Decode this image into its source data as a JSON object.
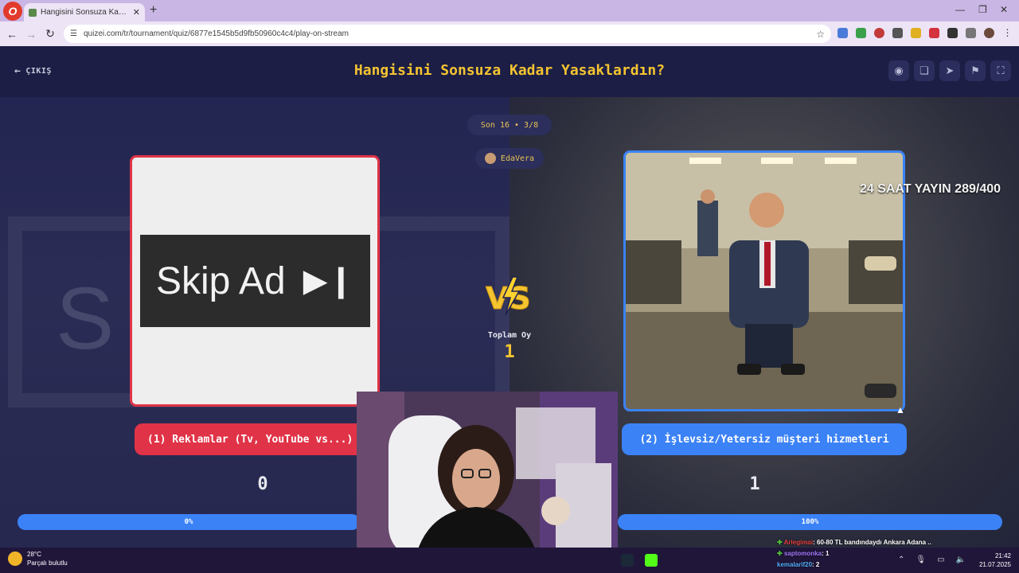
{
  "browser": {
    "tab_title": "Hangisini Sonsuza Kadar Yasaklardın?",
    "url": "quizei.com/tr/tournament/quiz/6877e1545b5d9fb50960c4c4/play-on-stream"
  },
  "header": {
    "exit_label": "ÇIKIŞ",
    "title": "Hangisini Sonsuza Kadar Yasaklardın?"
  },
  "round": {
    "label": "Son 16 • 3/8"
  },
  "author": {
    "name": "EdaVera"
  },
  "left_option": {
    "image_text": "Skip Ad",
    "label": "(1) Reklamlar (Tv, YouTube vs...)",
    "votes": "0",
    "percent_label": "0%",
    "accent": "#e03347"
  },
  "right_option": {
    "overlay_text": "24 SAAT YAYIN 289/400",
    "label": "(2) İşlevsiz/Yetersiz müşteri hizmetleri",
    "votes": "1",
    "percent_label": "100%",
    "accent": "#3b82f6"
  },
  "total": {
    "label": "Toplam Oy",
    "value": "1"
  },
  "taskbar": {
    "temperature": "28°C",
    "weather": "Parçalı bulutlu",
    "time": "21:42",
    "date": "21.07.2025"
  },
  "chat": [
    {
      "user": "Arlegimai",
      "message": ": 60-80 TL bandındaydı Ankara Adana .."
    },
    {
      "user": "saptomonka",
      "message": ": 1"
    },
    {
      "user": "kemalarif20",
      "message": ": 2"
    }
  ]
}
